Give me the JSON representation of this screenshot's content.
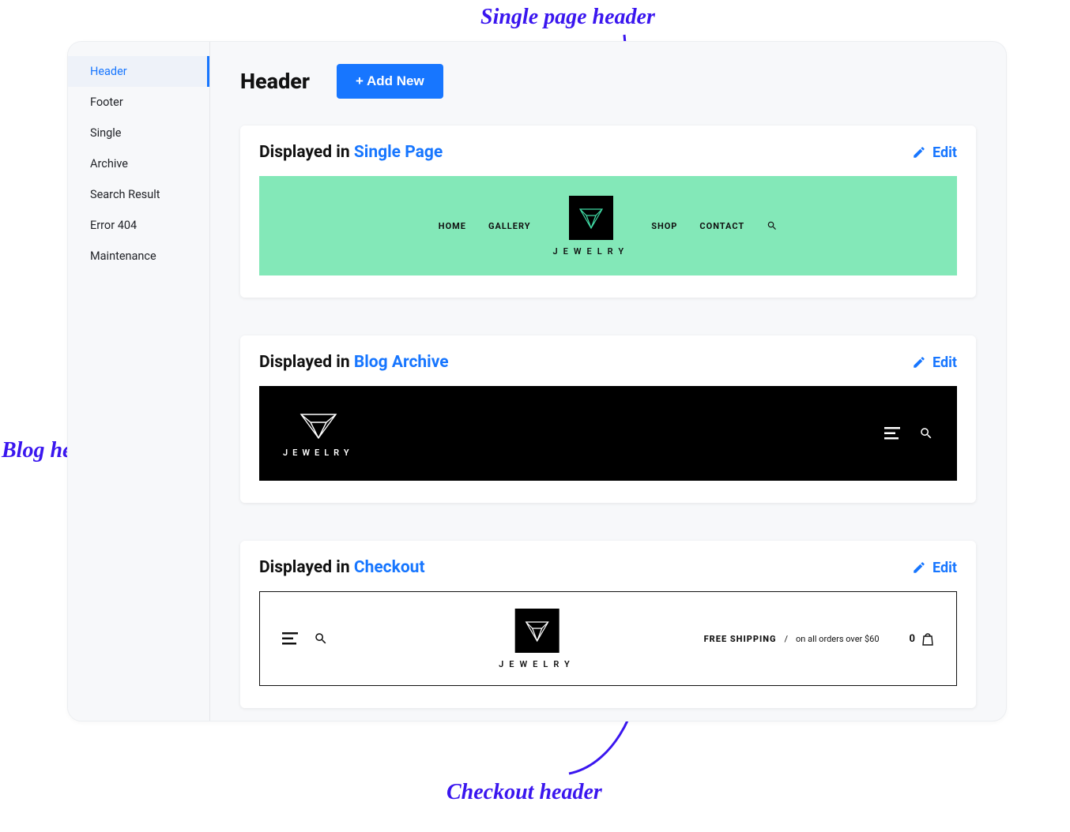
{
  "sidebar": {
    "items": [
      {
        "label": "Header",
        "active": true
      },
      {
        "label": "Footer",
        "active": false
      },
      {
        "label": "Single",
        "active": false
      },
      {
        "label": "Archive",
        "active": false
      },
      {
        "label": "Search Result",
        "active": false
      },
      {
        "label": "Error 404",
        "active": false
      },
      {
        "label": "Maintenance",
        "active": false
      }
    ]
  },
  "page": {
    "title": "Header",
    "add_button": "+ Add New"
  },
  "cards": {
    "displayed_prefix": "Displayed in ",
    "edit_label": "Edit",
    "single": {
      "location": "Single Page"
    },
    "archive": {
      "location": "Blog Archive"
    },
    "checkout": {
      "location": "Checkout"
    }
  },
  "preview_green": {
    "nav": [
      "HOME",
      "GALLERY",
      "SHOP",
      "CONTACT"
    ],
    "logo_text": "JEWELRY"
  },
  "preview_black": {
    "logo_text": "JEWELRY"
  },
  "preview_white": {
    "logo_text": "JEWELRY",
    "promo_bold": "FREE SHIPPING",
    "promo_sep": "/",
    "promo_detail": "on all orders over $60",
    "cart_count": "0"
  },
  "annotations": {
    "single": "Single page header",
    "blog": "Blog header",
    "checkout": "Checkout header"
  }
}
